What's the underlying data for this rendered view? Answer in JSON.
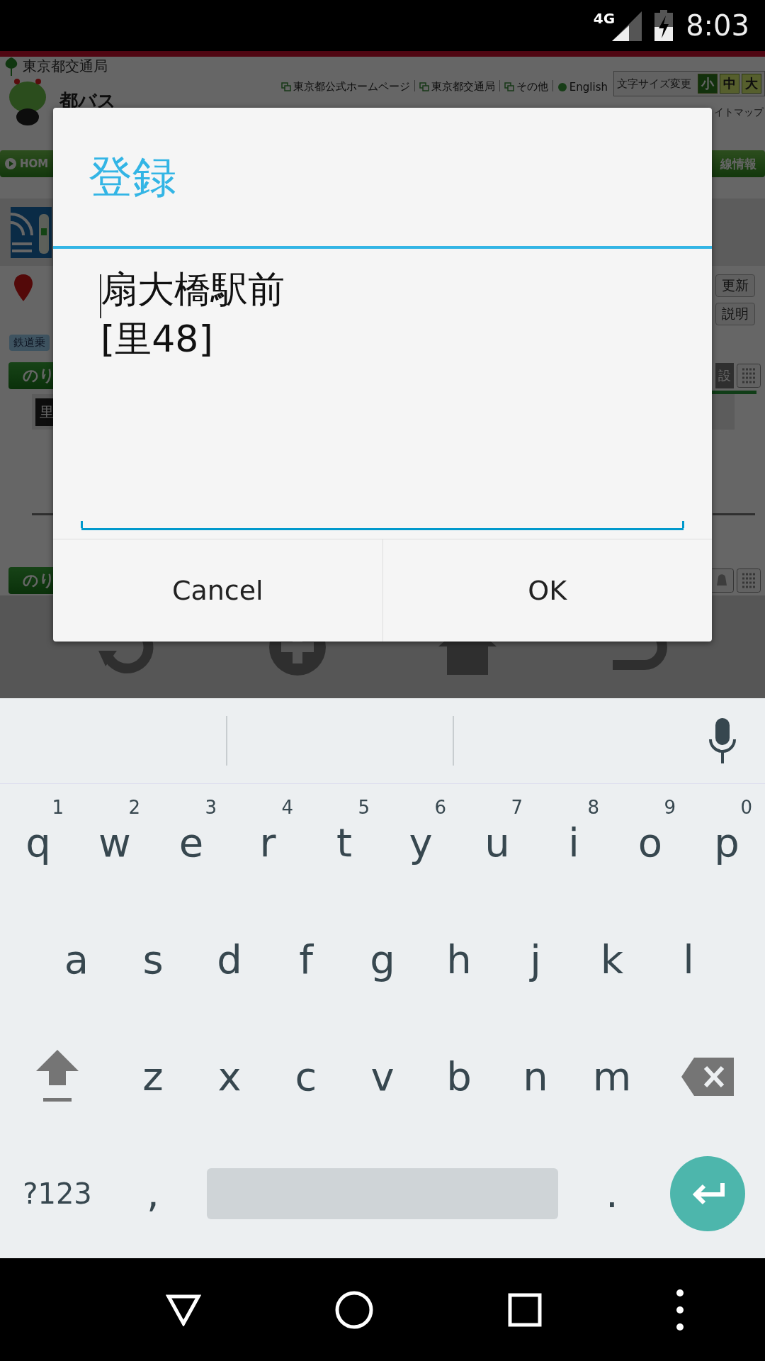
{
  "status_bar": {
    "network": "4G",
    "time": "8:03"
  },
  "web_page": {
    "agency": "東京都交通局",
    "brand": "都バス",
    "header_links": [
      "東京都公式ホームページ",
      "東京都交通局",
      "その他",
      "English"
    ],
    "font_size": {
      "label": "文字サイズ変更",
      "options": [
        {
          "label": "小",
          "selected": true
        },
        {
          "label": "中",
          "selected": false
        },
        {
          "label": "大",
          "selected": false
        }
      ]
    },
    "sitemap": "イトマップ",
    "nav": {
      "left": "HOM",
      "right": "線情報"
    },
    "side_buttons": [
      "更新",
      "説明"
    ],
    "tag": "鉄道乗",
    "sections": [
      {
        "title": "のり",
        "right_label": "設"
      },
      {
        "title": "のり"
      }
    ],
    "route_badge": "里"
  },
  "dialog": {
    "title": "登録",
    "value_lines": [
      "扇大橋駅前",
      "[里48]"
    ],
    "buttons": [
      "Cancel",
      "OK"
    ]
  },
  "keyboard": {
    "rows": [
      [
        {
          "key": "q",
          "hint": "1"
        },
        {
          "key": "w",
          "hint": "2"
        },
        {
          "key": "e",
          "hint": "3"
        },
        {
          "key": "r",
          "hint": "4"
        },
        {
          "key": "t",
          "hint": "5"
        },
        {
          "key": "y",
          "hint": "6"
        },
        {
          "key": "u",
          "hint": "7"
        },
        {
          "key": "i",
          "hint": "8"
        },
        {
          "key": "o",
          "hint": "9"
        },
        {
          "key": "p",
          "hint": "0"
        }
      ],
      [
        {
          "key": "a"
        },
        {
          "key": "s"
        },
        {
          "key": "d"
        },
        {
          "key": "f"
        },
        {
          "key": "g"
        },
        {
          "key": "h"
        },
        {
          "key": "j"
        },
        {
          "key": "k"
        },
        {
          "key": "l"
        }
      ],
      [
        {
          "key": "z"
        },
        {
          "key": "x"
        },
        {
          "key": "c"
        },
        {
          "key": "v"
        },
        {
          "key": "b"
        },
        {
          "key": "n"
        },
        {
          "key": "m"
        }
      ]
    ],
    "symbols": "?123",
    "comma": ",",
    "period": "."
  }
}
